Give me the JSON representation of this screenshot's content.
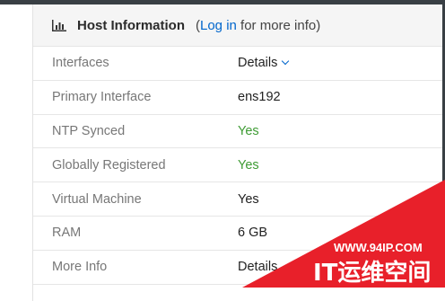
{
  "panel": {
    "title": "Host Information",
    "note_open": "(",
    "login_link": "Log in",
    "note_rest": " for more info)"
  },
  "rows": [
    {
      "label": "Interfaces",
      "value": "Details"
    },
    {
      "label": "Primary Interface",
      "value": "ens192"
    },
    {
      "label": "NTP Synced",
      "value": "Yes"
    },
    {
      "label": "Globally Registered",
      "value": "Yes"
    },
    {
      "label": "Virtual Machine",
      "value": "Yes"
    },
    {
      "label": "RAM",
      "value": "6 GB"
    },
    {
      "label": "More Info",
      "value": "Details"
    }
  ],
  "watermark": {
    "url": "WWW.94IP.COM",
    "brand": "IT运维空间"
  },
  "colors": {
    "link": "#0066cc",
    "success": "#3f9c35",
    "watermark_red": "#e8202a"
  },
  "icons": {
    "header": "bar-chart-icon",
    "expand": "chevron-down-icon"
  }
}
